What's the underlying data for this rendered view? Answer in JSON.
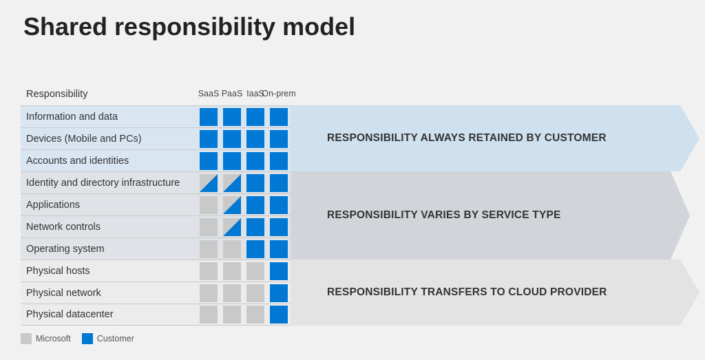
{
  "title": "Shared responsibility model",
  "columns": [
    "SaaS",
    "PaaS",
    "IaaS",
    "On-\nprem"
  ],
  "columns_plain": [
    "SaaS",
    "PaaS",
    "IaaS",
    "On-prem"
  ],
  "responsibility_header": "Responsibility",
  "bands": [
    {
      "label": "RESPONSIBILITY ALWAYS RETAINED BY CUSTOMER"
    },
    {
      "label": "RESPONSIBILITY VARIES BY SERVICE TYPE"
    },
    {
      "label": "RESPONSIBILITY TRANSFERS TO CLOUD PROVIDER"
    }
  ],
  "legend": {
    "microsoft": "Microsoft",
    "customer": "Customer"
  },
  "chart_data": {
    "type": "table",
    "title": "Shared responsibility model",
    "columns": [
      "SaaS",
      "PaaS",
      "IaaS",
      "On-prem"
    ],
    "value_legend": {
      "M": "Microsoft",
      "C": "Customer",
      "S": "Shared (Microsoft + Customer)"
    },
    "groups": [
      {
        "band": "RESPONSIBILITY ALWAYS RETAINED BY CUSTOMER",
        "rows": [
          {
            "label": "Information and data",
            "values": [
              "C",
              "C",
              "C",
              "C"
            ]
          },
          {
            "label": "Devices (Mobile and PCs)",
            "values": [
              "C",
              "C",
              "C",
              "C"
            ]
          },
          {
            "label": "Accounts and identities",
            "values": [
              "C",
              "C",
              "C",
              "C"
            ]
          }
        ]
      },
      {
        "band": "RESPONSIBILITY VARIES BY SERVICE TYPE",
        "rows": [
          {
            "label": "Identity and directory infrastructure",
            "values": [
              "S",
              "S",
              "C",
              "C"
            ]
          },
          {
            "label": "Applications",
            "values": [
              "M",
              "S",
              "C",
              "C"
            ]
          },
          {
            "label": "Network controls",
            "values": [
              "M",
              "S",
              "C",
              "C"
            ]
          },
          {
            "label": "Operating system",
            "values": [
              "M",
              "M",
              "C",
              "C"
            ]
          }
        ]
      },
      {
        "band": "RESPONSIBILITY TRANSFERS TO CLOUD PROVIDER",
        "rows": [
          {
            "label": "Physical hosts",
            "values": [
              "M",
              "M",
              "M",
              "C"
            ]
          },
          {
            "label": "Physical network",
            "values": [
              "M",
              "M",
              "M",
              "C"
            ]
          },
          {
            "label": "Physical datacenter",
            "values": [
              "M",
              "M",
              "M",
              "C"
            ]
          }
        ]
      }
    ]
  }
}
